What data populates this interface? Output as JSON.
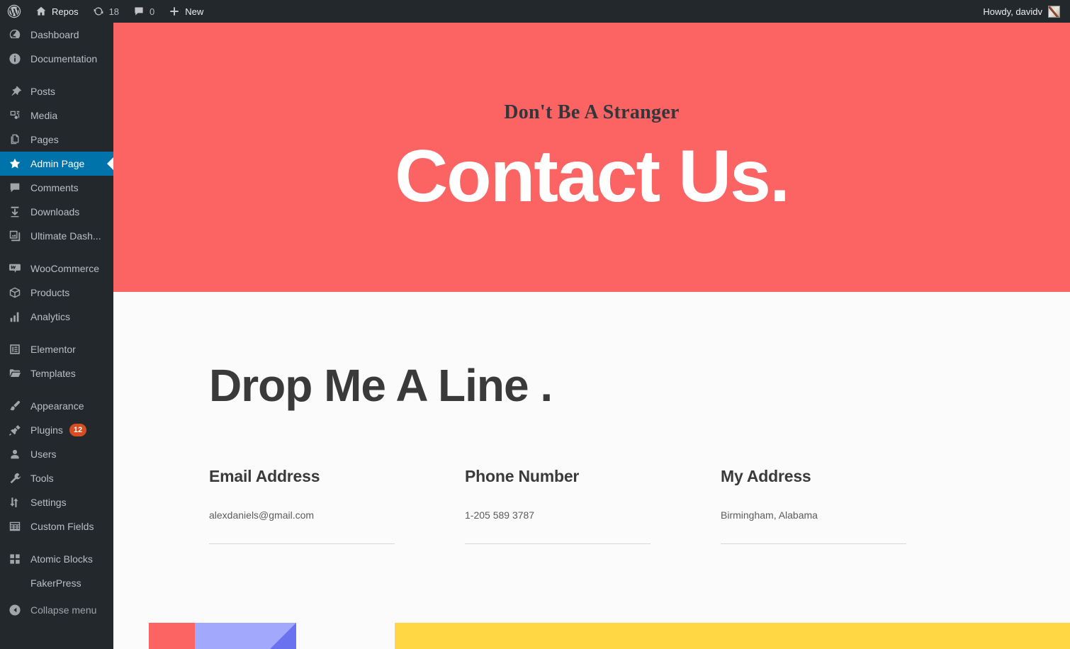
{
  "adminbar": {
    "logo_icon": "wordpress-logo-icon",
    "site_name": "Repos",
    "site_icon": "home-icon",
    "updates_icon": "updates-icon",
    "updates_count": "18",
    "comments_icon": "comment-bubble-icon",
    "comments_count": "0",
    "new_icon": "plus-icon",
    "new_label": "New",
    "greeting": "Howdy, davidv",
    "avatar_icon": "user-avatar"
  },
  "sidebar": {
    "items": [
      {
        "label": "Dashboard",
        "icon": "dashboard-icon",
        "key": "dashboard"
      },
      {
        "label": "Documentation",
        "icon": "info-icon",
        "key": "documentation"
      },
      {
        "separator": true
      },
      {
        "label": "Posts",
        "icon": "pin-icon",
        "key": "posts"
      },
      {
        "label": "Media",
        "icon": "media-icon",
        "key": "media"
      },
      {
        "label": "Pages",
        "icon": "pages-icon",
        "key": "pages"
      },
      {
        "label": "Admin Page",
        "icon": "star-icon",
        "key": "admin-page",
        "active": true
      },
      {
        "label": "Comments",
        "icon": "comment-bubble-icon",
        "key": "comments"
      },
      {
        "label": "Downloads",
        "icon": "download-icon",
        "key": "downloads"
      },
      {
        "label": "Ultimate Dash...",
        "icon": "gallery-icon",
        "key": "ultimate-dashboard"
      },
      {
        "separator": true
      },
      {
        "label": "WooCommerce",
        "icon": "woocommerce-icon",
        "key": "woocommerce"
      },
      {
        "label": "Products",
        "icon": "box-icon",
        "key": "products"
      },
      {
        "label": "Analytics",
        "icon": "bar-chart-icon",
        "key": "analytics"
      },
      {
        "separator": true
      },
      {
        "label": "Elementor",
        "icon": "elementor-icon",
        "key": "elementor"
      },
      {
        "label": "Templates",
        "icon": "folder-icon",
        "key": "templates"
      },
      {
        "separator": true
      },
      {
        "label": "Appearance",
        "icon": "paintbrush-icon",
        "key": "appearance"
      },
      {
        "label": "Plugins",
        "icon": "plug-icon",
        "key": "plugins",
        "badge": "12"
      },
      {
        "label": "Users",
        "icon": "user-icon",
        "key": "users"
      },
      {
        "label": "Tools",
        "icon": "wrench-icon",
        "key": "tools"
      },
      {
        "label": "Settings",
        "icon": "sliders-icon",
        "key": "settings"
      },
      {
        "label": "Custom Fields",
        "icon": "table-icon",
        "key": "custom-fields"
      },
      {
        "separator": true
      },
      {
        "label": "Atomic Blocks",
        "icon": "blocks-icon",
        "key": "atomic-blocks"
      },
      {
        "label": "FakerPress",
        "icon": null,
        "key": "fakerpress"
      }
    ],
    "collapse": {
      "label": "Collapse menu",
      "icon": "collapse-arrow-icon"
    }
  },
  "hero": {
    "eyebrow": "Don't Be A Stranger",
    "title": "Contact Us.",
    "background": "#fc6464"
  },
  "section": {
    "title": "Drop Me A Line .",
    "columns": [
      {
        "label": "Email Address",
        "value": "alexdaniels@gmail.com"
      },
      {
        "label": "Phone Number",
        "value": "1-205 589 3787"
      },
      {
        "label": "My Address",
        "value": "Birmingham, Alabama"
      }
    ]
  },
  "decor": {
    "red": "#fc6464",
    "blue_light": "#a2a8fb",
    "blue_dark": "#6a72f0",
    "yellow": "#ffd644"
  }
}
